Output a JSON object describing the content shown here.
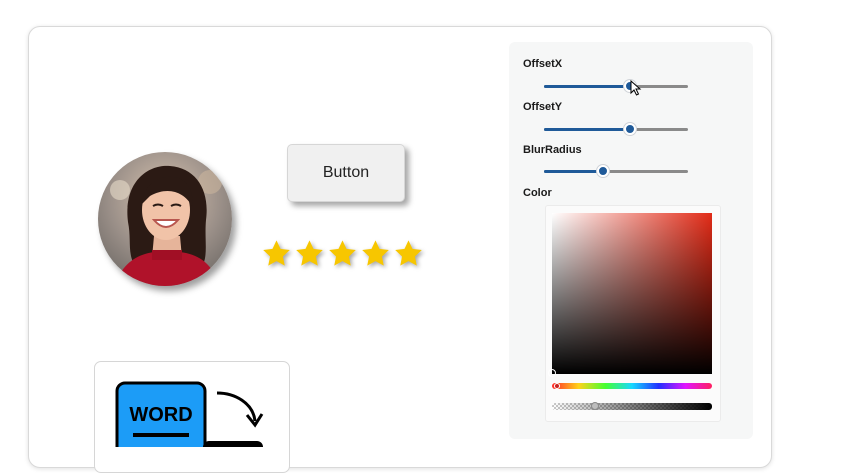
{
  "demo": {
    "button_label": "Button",
    "rating": {
      "value": 5,
      "max": 5,
      "star_color": "#f7c600"
    },
    "word_icon": {
      "label": "WORD",
      "color": "#1c9cf7"
    }
  },
  "panel": {
    "offset_x": {
      "label": "OffsetX",
      "value_fraction": 0.6
    },
    "offset_y": {
      "label": "OffsetY",
      "value_fraction": 0.6
    },
    "blur_radius": {
      "label": "BlurRadius",
      "value_fraction": 0.41
    },
    "color": {
      "label": "Color",
      "selected_hex": "#000000",
      "hue_hex": "#e22b17",
      "accent_hex": "#1f5a99"
    }
  }
}
